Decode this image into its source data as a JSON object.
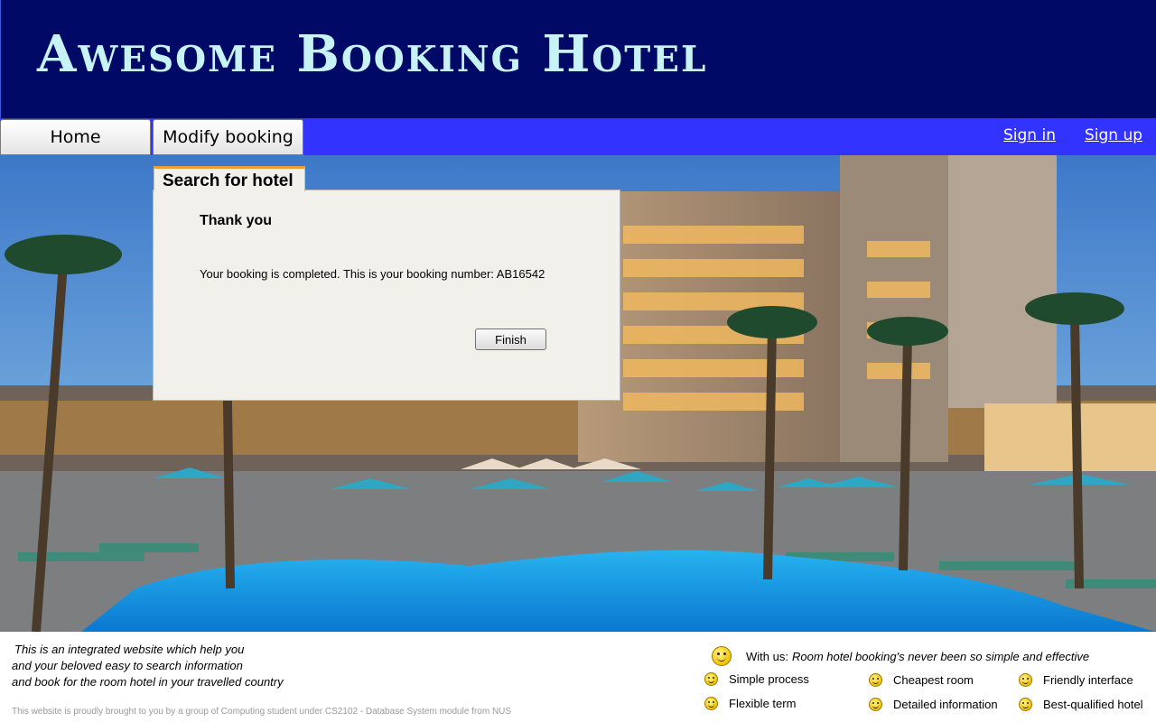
{
  "header": {
    "title": "Awesome Booking Hotel"
  },
  "nav": {
    "home": "Home",
    "modify_booking": "Modify booking",
    "sign_in": "Sign in",
    "sign_up": "Sign up"
  },
  "panel": {
    "tab_label": "Search for hotel",
    "heading": "Thank you",
    "message": "Your booking is completed. This is your booking number: AB16542",
    "finish_button": "Finish"
  },
  "footer": {
    "intro_lines": [
      "This is an integrated website which help you",
      "and your beloved easy to search information",
      "and book for the room hotel in your travelled country"
    ],
    "credit": "This website is proudly brought to you by a group of Computing student under CS2102 - Database System module from NUS",
    "with_us_label": "With us:",
    "tagline": "Room hotel booking's never been so simple and effective",
    "features": [
      "Simple process",
      "Cheapest room",
      "Friendly interface",
      "Flexible term",
      "Detailed information",
      "Best-qualified hotel"
    ]
  },
  "colors": {
    "header_bg": "#000a66",
    "title_color": "#c8f3f6",
    "navbar_bg": "#3333ff",
    "tab_accent": "#f0a030"
  },
  "icons": {
    "feature": "smiley-icon",
    "with_us": "winking-smiley-icon"
  }
}
